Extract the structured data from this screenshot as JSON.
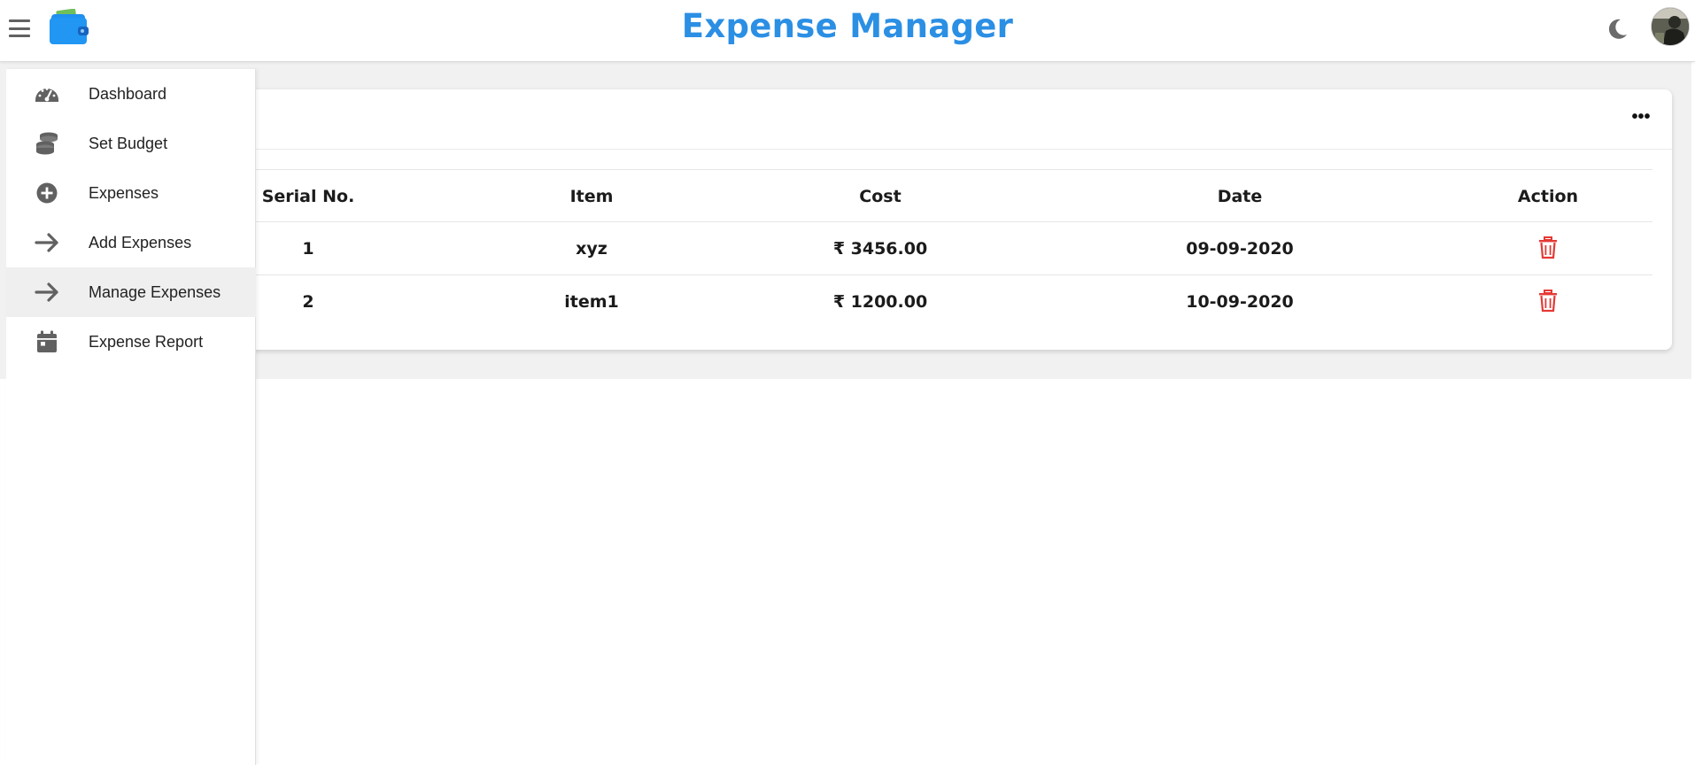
{
  "header": {
    "title": "Expense Manager",
    "menu_icon": "hamburger-menu-icon",
    "logo_icon": "wallet-icon",
    "theme_icon": "moon-icon",
    "avatar_icon": "user-avatar"
  },
  "colors": {
    "brand": "#2b8fe4",
    "delete": "#e53935",
    "icon_gray": "#616161",
    "active_bg": "#efefef"
  },
  "sidebar": {
    "items": [
      {
        "label": "Dashboard",
        "icon": "speedometer-icon"
      },
      {
        "label": "Set Budget",
        "icon": "coins-stack-icon"
      },
      {
        "label": "Expenses",
        "icon": "plus-circle-icon"
      },
      {
        "label": "Add Expenses",
        "icon": "arrow-right-icon"
      },
      {
        "label": "Manage Expenses",
        "icon": "arrow-right-icon",
        "active": true
      },
      {
        "label": "Expense Report",
        "icon": "calendar-icon"
      }
    ]
  },
  "table": {
    "more_icon": "more-horizontal-icon",
    "columns": [
      "Serial No.",
      "Item",
      "Cost",
      "Date",
      "Action"
    ],
    "rows": [
      {
        "serial": "1",
        "item": "xyz",
        "cost": "₹ 3456.00",
        "date": "09-09-2020",
        "action_icon": "trash-icon"
      },
      {
        "serial": "2",
        "item": "item1",
        "cost": "₹ 1200.00",
        "date": "10-09-2020",
        "action_icon": "trash-icon"
      }
    ]
  }
}
